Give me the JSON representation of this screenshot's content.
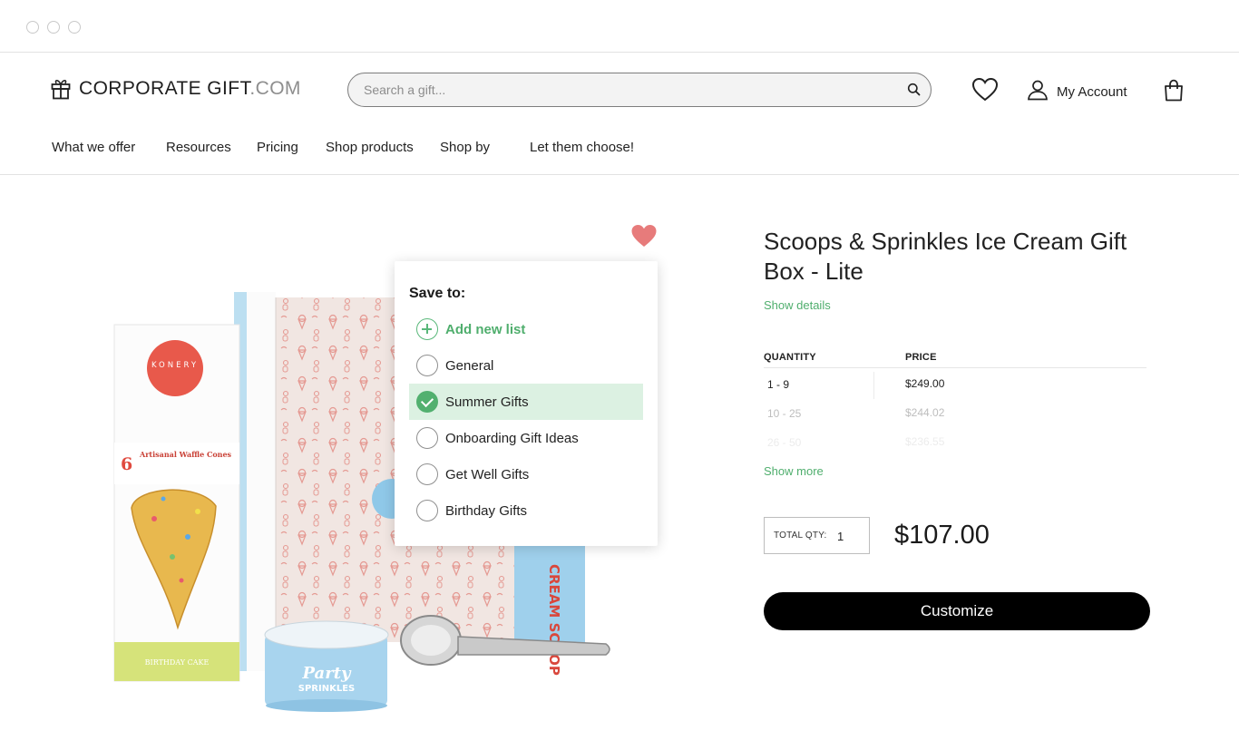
{
  "window": {
    "controls": [
      "window-dot",
      "window-dot",
      "window-dot"
    ]
  },
  "header": {
    "brand_main": "CORPORATE GIFT",
    "brand_domain": ".COM",
    "brand_icon": "gift-icon",
    "search_placeholder": "Search a gift...",
    "search_value": "",
    "search_icon": "search-icon",
    "wishlist_icon": "heart-outline-icon",
    "account_icon": "user-icon",
    "account_label": "My Account",
    "cart_icon": "shopping-bag-icon"
  },
  "nav": {
    "items": [
      {
        "label": "What we offer"
      },
      {
        "label": "Resources"
      },
      {
        "label": "Pricing"
      },
      {
        "label": "Shop products"
      },
      {
        "label": "Shop by"
      },
      {
        "label": "Let them choose!"
      }
    ]
  },
  "product": {
    "title": "Scoops & Sprinkles Ice Cream Gift Box - Lite",
    "show_details": "Show details",
    "image_label_brand": "KONERY",
    "image_label_count": "6",
    "image_label_cones": "Artisanal Waffle Cones",
    "image_label_flavor": "BIRTHDAY CAKE",
    "image_label_can": "Party",
    "image_label_can2": "SPRINKLES",
    "image_label_side": "CREAM SCOOP",
    "favorite_icon": "heart-filled-icon",
    "pricing": {
      "quantity_header": "QUANTITY",
      "price_header": "PRICE",
      "rows": [
        {
          "quantity": "1 - 9",
          "price": "$249.00"
        },
        {
          "quantity": "10 - 25",
          "price": "$244.02"
        },
        {
          "quantity": "26 - 50",
          "price": "$236.55"
        }
      ]
    },
    "show_more": "Show more",
    "total_qty_label": "TOTAL QTY:",
    "total_qty_value": "1",
    "total_price": "$107.00",
    "customize_label": "Customize"
  },
  "save_popup": {
    "title": "Save to:",
    "add_new": "Add new list",
    "add_icon": "plus-circle-icon",
    "check_icon": "check-circle-icon",
    "selected_list": "Summer Gifts",
    "lists": [
      {
        "label": "General"
      },
      {
        "label": "Summer Gifts"
      },
      {
        "label": "Onboarding Gift Ideas"
      },
      {
        "label": "Get Well Gifts"
      },
      {
        "label": "Birthday Gifts"
      }
    ]
  },
  "colors": {
    "accent_green": "#4fae6d",
    "selected_bg": "#dcf1e2",
    "heart_pink": "#e77b7b",
    "button_black": "#000000"
  }
}
